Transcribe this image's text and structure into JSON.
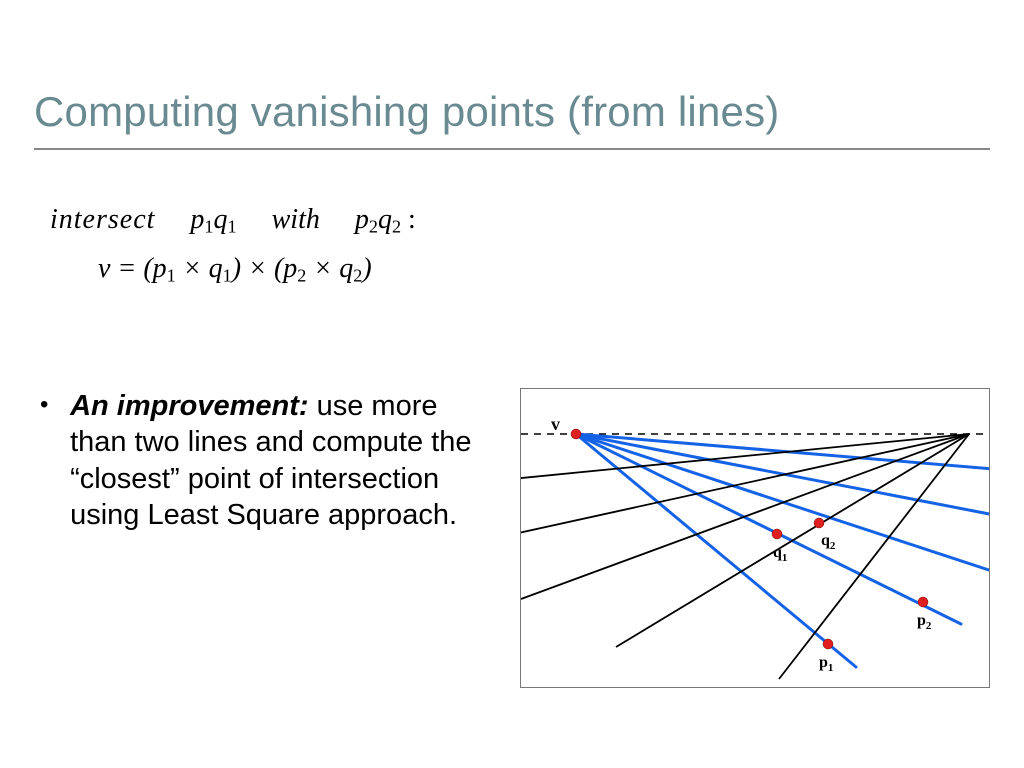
{
  "title": "Computing vanishing points (from lines)",
  "formula": {
    "intersect": "intersect",
    "with": "with",
    "p1q1_p": "p",
    "p1q1_p_sub": "1",
    "p1q1_q": "q",
    "p1q1_q_sub": "1",
    "p2q2_p": "p",
    "p2q2_p_sub": "2",
    "p2q2_q": "q",
    "p2q2_q_sub": "2",
    "colon": " :",
    "row2": "v = (p",
    "row2_s1": "1",
    "row2_b": " × q",
    "row2_s2": "1",
    "row2_c": ") × (p",
    "row2_s3": "2",
    "row2_d": " × q",
    "row2_s4": "2",
    "row2_e": ")"
  },
  "bullet": {
    "dot": "•",
    "lead": "An improvement:",
    "rest": " use more than two lines and compute the “closest” point of intersection using Least Square approach."
  },
  "diagram": {
    "labels": {
      "v": "v",
      "q1": "q",
      "q1s": "1",
      "q2": "q",
      "q2s": "2",
      "p1": "p",
      "p1s": "1",
      "p2": "p",
      "p2s": "2"
    }
  }
}
